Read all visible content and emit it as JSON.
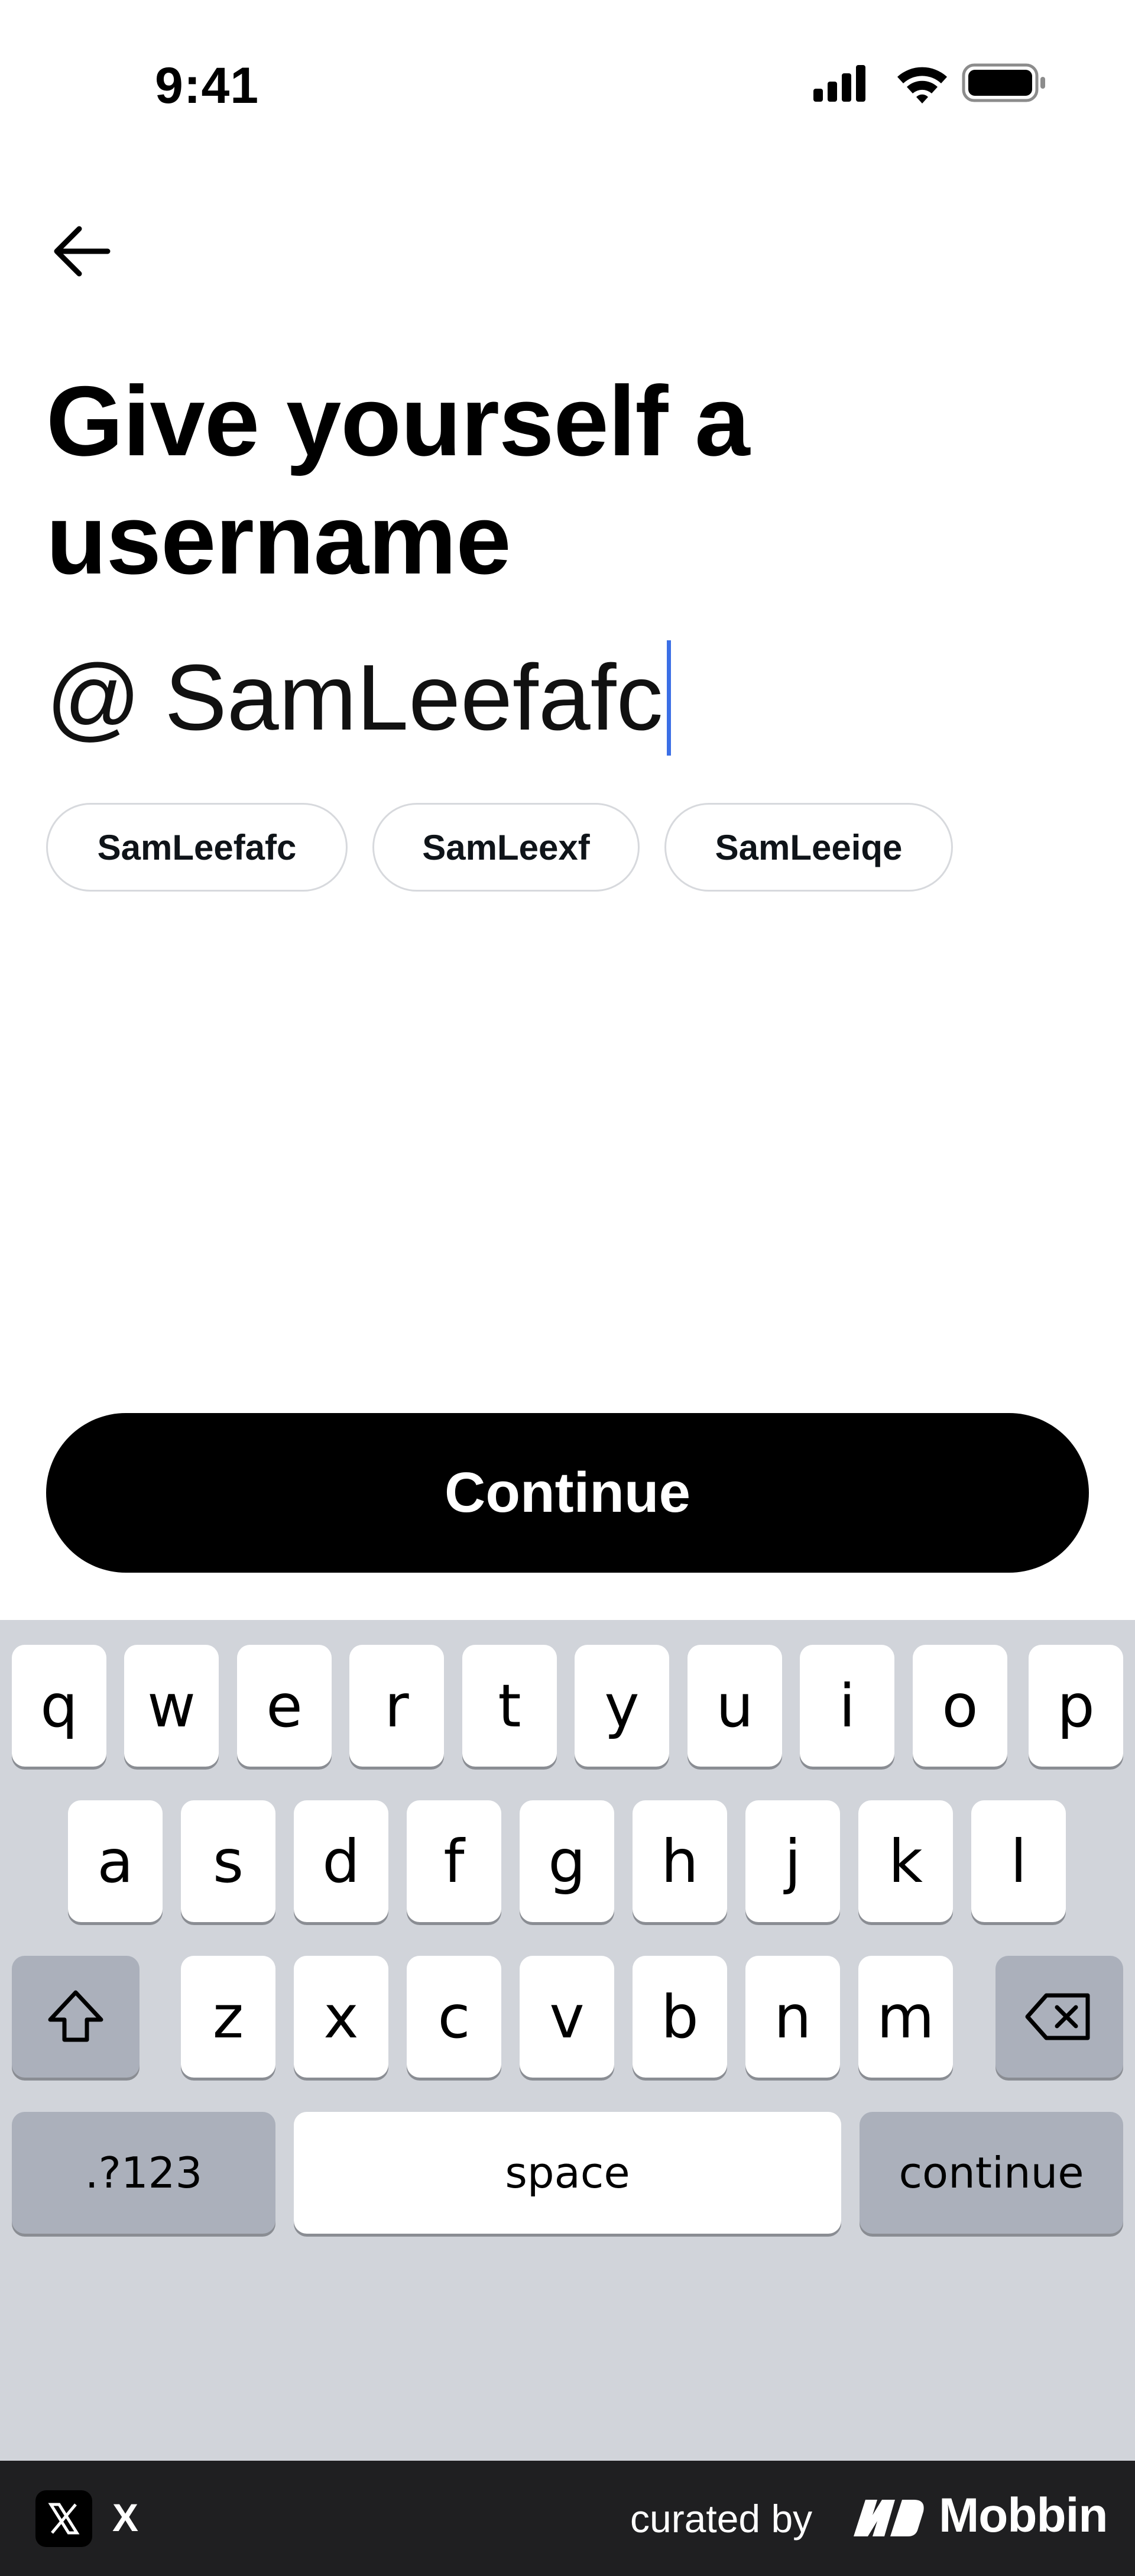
{
  "status_bar": {
    "time": "9:41",
    "icons": [
      "cellular-signal-icon",
      "wifi-icon",
      "battery-icon"
    ]
  },
  "header": {
    "back_icon": "arrow-left-icon"
  },
  "main": {
    "title_line1": "Give yourself a",
    "title_line2": "username",
    "username_prefix": "@",
    "username_value": "SamLeefafc",
    "suggestions": [
      "SamLeefafc",
      "SamLeexf",
      "SamLeeiqe"
    ],
    "continue_label": "Continue"
  },
  "keyboard": {
    "row1": [
      "q",
      "w",
      "e",
      "r",
      "t",
      "y",
      "u",
      "i",
      "o",
      "p"
    ],
    "row2": [
      "a",
      "s",
      "d",
      "f",
      "g",
      "h",
      "j",
      "k",
      "l"
    ],
    "row3": [
      "z",
      "x",
      "c",
      "v",
      "b",
      "n",
      "m"
    ],
    "shift_icon": "shift-icon",
    "delete_icon": "backspace-icon",
    "numbers_label": ".?123",
    "space_label": "space",
    "return_label": "continue"
  },
  "footer": {
    "app_name": "X",
    "curated_by": "curated by",
    "brand": "Mobbin"
  },
  "colors": {
    "cursor": "#3b6fe6",
    "keyboard_bg": "#d1d4da",
    "dark_key": "#abb0bb",
    "footer_bg": "#1f1f21"
  }
}
